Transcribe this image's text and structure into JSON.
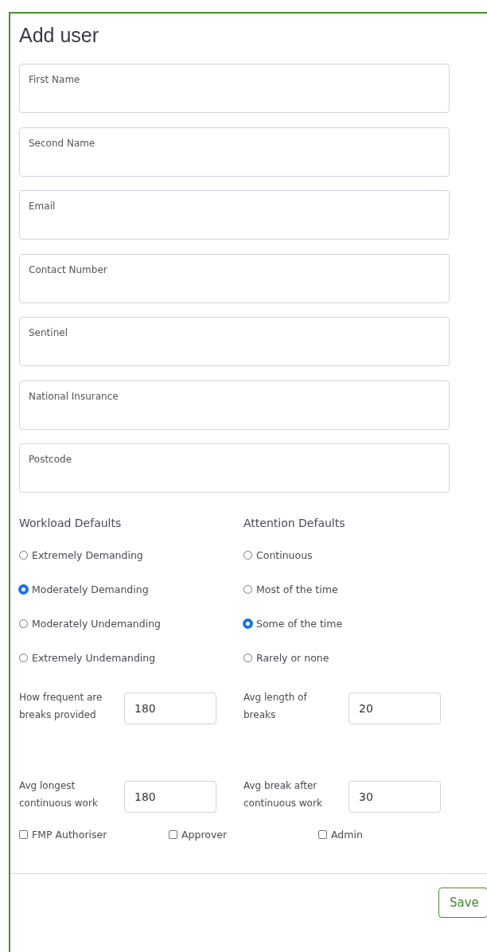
{
  "title": "Add user",
  "fields": [
    {
      "placeholder": "First Name"
    },
    {
      "placeholder": "Second Name"
    },
    {
      "placeholder": "Email"
    },
    {
      "placeholder": "Contact Number"
    },
    {
      "placeholder": "Sentinel"
    },
    {
      "placeholder": "National Insurance"
    },
    {
      "placeholder": "Postcode"
    }
  ],
  "radio_groups": [
    {
      "heading": "Workload Defaults",
      "options": [
        {
          "label": "Extremely Demanding",
          "selected": false
        },
        {
          "label": "Moderately Demanding",
          "selected": true
        },
        {
          "label": "Moderately Undemanding",
          "selected": false
        },
        {
          "label": "Extremely Undemanding",
          "selected": false
        }
      ]
    },
    {
      "heading": "Attention Defaults",
      "options": [
        {
          "label": "Continuous",
          "selected": false
        },
        {
          "label": "Most of the time",
          "selected": false
        },
        {
          "label": "Some of the time",
          "selected": true
        },
        {
          "label": "Rarely or none",
          "selected": false
        }
      ]
    }
  ],
  "number_rows": [
    [
      {
        "label": "How frequent are breaks provided",
        "value": "180"
      },
      {
        "label": "Avg length of breaks",
        "value": "20"
      }
    ],
    [
      {
        "label": "Avg longest continuous work",
        "value": "180"
      },
      {
        "label": "Avg break after continuous work",
        "value": "30"
      }
    ]
  ],
  "roles": [
    {
      "label": "FMP Authoriser",
      "checked": false
    },
    {
      "label": "Approver",
      "checked": false
    },
    {
      "label": "Admin",
      "checked": false
    }
  ],
  "save_button": "Save"
}
